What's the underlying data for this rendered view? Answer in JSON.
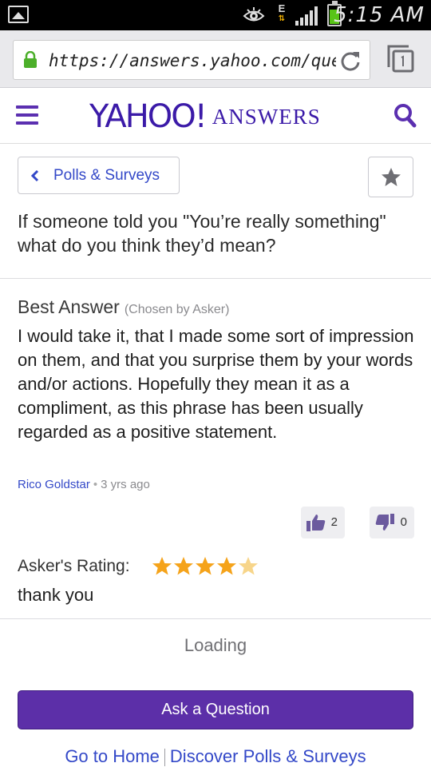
{
  "status_bar": {
    "time": "5:15 AM",
    "network_letter": "E",
    "icons": [
      "image-notification-icon",
      "eye-icon",
      "data-activity-icon",
      "signal-bars-icon",
      "battery-icon"
    ],
    "battery_color": "#58c417"
  },
  "browser": {
    "url": "https://answers.yahoo.com/questi",
    "icons": [
      "lock-icon",
      "reload-icon",
      "tabs-icon"
    ],
    "secure_color": "#4caf2a"
  },
  "header": {
    "logo_main": "YAHOO!",
    "logo_sub": "ANSWERS",
    "brand_color": "#3b1aa8",
    "icons": [
      "menu-icon",
      "search-icon"
    ]
  },
  "breadcrumb": {
    "label": "Polls & Surveys"
  },
  "question": {
    "text": "If someone told you \"You’re really something\" what do you think they’d mean?"
  },
  "best_answer": {
    "title": "Best Answer",
    "chosen_note": "(Chosen by Asker)",
    "text": "I would take it, that I made some sort of impression on them, and that you surprise them by your words and/or actions. Hopefully they mean it as a compliment, as this phrase has been usually regarded as a positive statement.",
    "author": "Rico Goldstar",
    "separator": "•",
    "time_ago": "3 yrs ago",
    "thumbs_up": "2",
    "thumbs_down": "0"
  },
  "asker_rating": {
    "label": "Asker's Rating:",
    "stars": 4,
    "max_stars": 5,
    "star_color": "#f5a31a",
    "comment": "thank you"
  },
  "loading_text": "Loading",
  "ask_button": {
    "label": "Ask a Question",
    "color": "#5c2fa8"
  },
  "footer": {
    "home_link": "Go to Home",
    "discover_link": "Discover Polls & Surveys"
  }
}
